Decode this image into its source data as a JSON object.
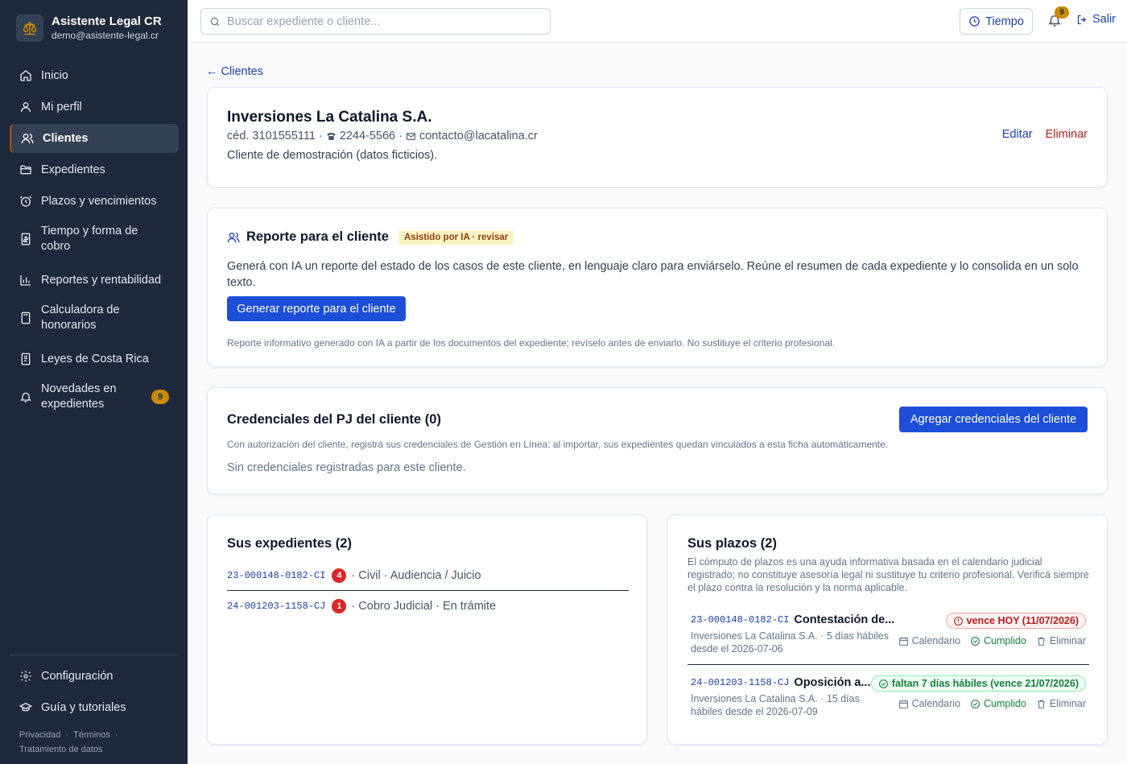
{
  "app": {
    "name": "Asistente Legal CR",
    "email": "demo@asistente-legal.cr"
  },
  "sidebar": {
    "items": [
      {
        "label": "Inicio",
        "icon": "home-icon"
      },
      {
        "label": "Mi perfil",
        "icon": "user-icon"
      },
      {
        "label": "Clientes",
        "icon": "users-icon"
      },
      {
        "label": "Expedientes",
        "icon": "folder-icon"
      },
      {
        "label": "Plazos y vencimientos",
        "icon": "alarm-icon"
      },
      {
        "label": "Tiempo y forma de cobro",
        "icon": "receipt-icon"
      },
      {
        "label": "Reportes y rentabilidad",
        "icon": "bar-chart-icon"
      },
      {
        "label": "Calculadora de honorarios",
        "icon": "calculator-icon"
      },
      {
        "label": "Leyes de Costa Rica",
        "icon": "book-icon"
      },
      {
        "label": "Novedades en expedientes",
        "icon": "bell-icon",
        "badge": "9"
      }
    ],
    "bottom": [
      {
        "label": "Configuración",
        "icon": "gear-icon"
      },
      {
        "label": "Guía y tutoriales",
        "icon": "graduation-cap-icon"
      }
    ],
    "legal": {
      "privacy": "Privacidad",
      "terms": "Términos",
      "data": "Tratamiento de datos",
      "sep": "·"
    }
  },
  "topbar": {
    "search_placeholder": "Buscar expediente o cliente...",
    "tiempo_label": "Tiempo",
    "notifications": "9",
    "salir_label": "Salir"
  },
  "back_link": "← Clientes",
  "client": {
    "name": "Inversiones La Catalina S.A.",
    "cedula": "céd. 3101555111",
    "phone": "2244-5566",
    "email": "contacto@lacatalina.cr",
    "sep": "·",
    "note": "Cliente de demostración (datos ficticios).",
    "edit_label": "Editar",
    "delete_label": "Eliminar"
  },
  "report": {
    "title": "Reporte para el cliente",
    "tag": "Asistido por IA · revisar",
    "description": "Generá con IA un reporte del estado de los casos de este cliente, en lenguaje claro para enviárselo. Reúne el resumen de cada expediente y lo consolida en un solo texto.",
    "button": "Generar reporte para el cliente",
    "disclaimer": "Reporte informativo generado con IA a partir de los documentos del expediente; revíselo antes de enviarlo. No sustituye el criterio profesional."
  },
  "credentials": {
    "title": "Credenciales del PJ del cliente (0)",
    "button": "Agregar credenciales del cliente",
    "description": "Con autorización del cliente, registrá sus credenciales de Gestión en Línea: al importar, sus expedientes quedan vinculados a esta ficha automáticamente.",
    "empty": "Sin credenciales registradas para este cliente."
  },
  "expedientes": {
    "title": "Sus expedientes (2)",
    "rows": [
      {
        "code": "23-000148-0182-CI",
        "count": "4",
        "desc": "· Civil · Audiencia / Juicio"
      },
      {
        "code": "24-001203-1158-CJ",
        "count": "1",
        "desc": "· Cobro Judicial · En trámite"
      }
    ]
  },
  "plazos": {
    "title": "Sus plazos (2)",
    "note": "El cómputo de plazos es una ayuda informativa basada en el calendario judicial registrado; no constituye asesoría legal ni sustituye tu criterio profesional. Verificá siempre el plazo contra la resolución y la norma aplicable.",
    "actions": {
      "calendar": "Calendario",
      "done": "Cumplido",
      "delete": "Eliminar"
    },
    "items": [
      {
        "code": "23-000148-0182-CI",
        "title": "Contestación de...",
        "sub": "Inversiones La Catalina S.A. · 5 días hábiles desde el 2026-07-06",
        "status": "vence HOY (11/07/2026)"
      },
      {
        "code": "24-001203-1158-CJ",
        "title": "Oposición a...",
        "sub": "Inversiones La Catalina S.A. · 15 días hábiles desde el 2026-07-09",
        "status": "faltan 7 días hábiles (vence 21/07/2026)"
      }
    ]
  }
}
